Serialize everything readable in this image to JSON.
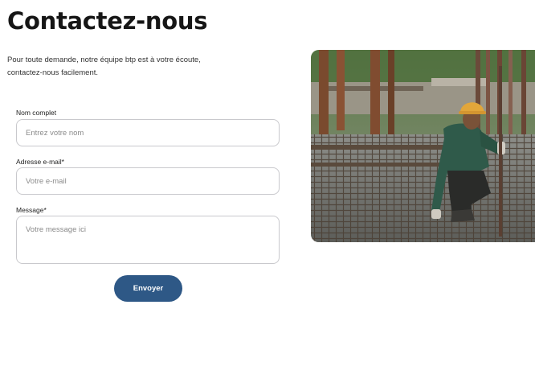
{
  "page": {
    "title": "Contactez-nous",
    "intro_line1": "Pour toute demande, notre équipe btp est à votre écoute,",
    "intro_line2": "contactez-nous facilement."
  },
  "form": {
    "name": {
      "label": "Nom complet",
      "placeholder": "Entrez votre nom"
    },
    "email": {
      "label": "Adresse e-mail*",
      "placeholder": "Votre e-mail"
    },
    "message": {
      "label": "Message*",
      "placeholder": "Votre message ici"
    },
    "submit_label": "Envoyer"
  },
  "colors": {
    "accent": "#2e5886",
    "title": "#161616",
    "field_border": "#c9c9cd"
  },
  "image": {
    "subject": "construction-worker-photo"
  }
}
